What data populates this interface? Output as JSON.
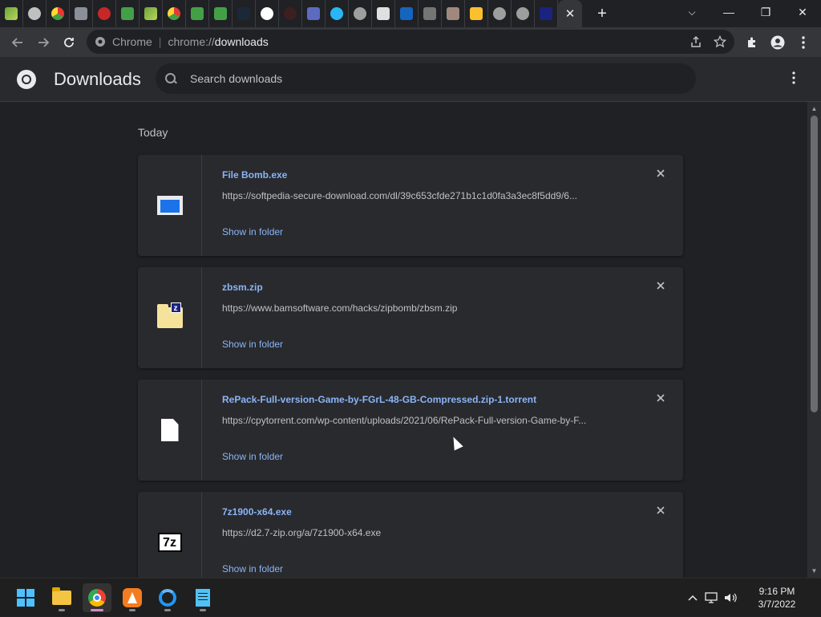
{
  "browser": {
    "tabs_count_label": "",
    "active_tab_close": "✕",
    "new_tab": "+",
    "tab_search": "⌵",
    "window": {
      "minimize": "—",
      "restore": "❐",
      "close": "✕"
    },
    "omnibox": {
      "site_label": "Chrome",
      "url_scheme": "chrome://",
      "url_path": "downloads"
    }
  },
  "downloads": {
    "title": "Downloads",
    "search_placeholder": "Search downloads",
    "section_today": "Today",
    "items": [
      {
        "name": "File Bomb.exe",
        "url": "https://softpedia-secure-download.com/dl/39c653cfde271b1c1d0fa3a3ec8f5dd9/6...",
        "action": "Show in folder",
        "icon": "exe-icon"
      },
      {
        "name": "zbsm.zip",
        "url": "https://www.bamsoftware.com/hacks/zipbomb/zbsm.zip",
        "action": "Show in folder",
        "icon": "zip-icon"
      },
      {
        "name": "RePack-Full-version-Game-by-FGrL-48-GB-Compressed.zip-1.torrent",
        "url": "https://cpytorrent.com/wp-content/uploads/2021/06/RePack-Full-version-Game-by-F...",
        "action": "Show in folder",
        "icon": "document-icon"
      },
      {
        "name": "7z1900-x64.exe",
        "url": "https://d2.7-zip.org/a/7z1900-x64.exe",
        "action": "Show in folder",
        "icon": "7zip-icon"
      }
    ]
  },
  "taskbar": {
    "time": "9:16 PM",
    "date": "3/7/2022",
    "apps": [
      "windows-start",
      "file-explorer",
      "chrome",
      "orange-app",
      "blue-app",
      "notepad"
    ]
  },
  "icon_7z_text": "7z",
  "icon_zip_badge": "z"
}
